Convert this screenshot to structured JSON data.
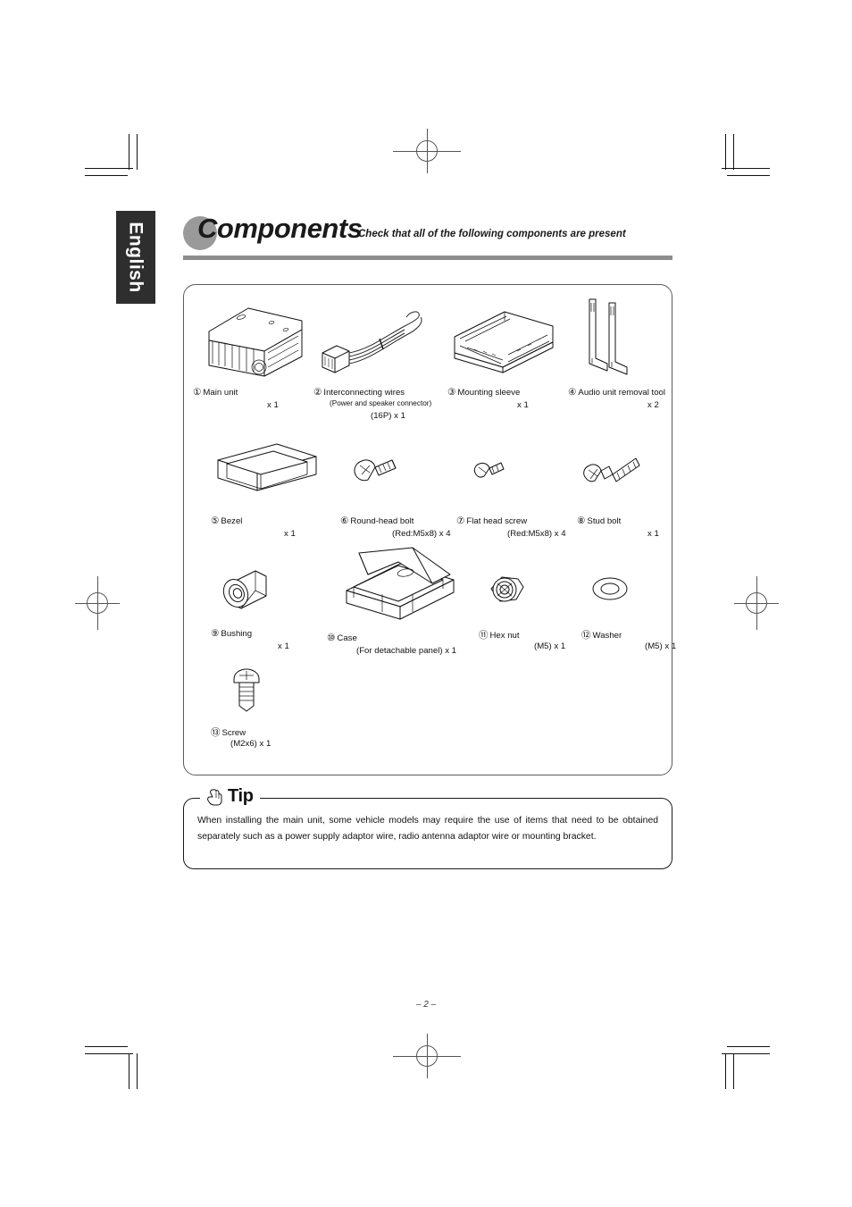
{
  "language_tab": "English",
  "header": {
    "title": "Components",
    "subtitle": "Check that all of the following components are present"
  },
  "components": [
    {
      "num": "1",
      "marker": "①",
      "name": "Main unit",
      "qty": "x 1",
      "note": ""
    },
    {
      "num": "2",
      "marker": "②",
      "name": "Interconnecting wires",
      "qty": "(16P) x 1",
      "note": "(Power and speaker connector)"
    },
    {
      "num": "3",
      "marker": "③",
      "name": "Mounting sleeve",
      "qty": "x 1",
      "note": ""
    },
    {
      "num": "4",
      "marker": "④",
      "name": "Audio unit removal tool",
      "qty": "x 2",
      "note": ""
    },
    {
      "num": "5",
      "marker": "⑤",
      "name": "Bezel",
      "qty": "x 1",
      "note": ""
    },
    {
      "num": "6",
      "marker": "⑥",
      "name": "Round-head bolt",
      "qty": "(Red:M5x8) x 4",
      "note": ""
    },
    {
      "num": "7",
      "marker": "⑦",
      "name": "Flat head screw",
      "qty": "(Red:M5x8) x 4",
      "note": ""
    },
    {
      "num": "8",
      "marker": "⑧",
      "name": "Stud bolt",
      "qty": "x 1",
      "note": ""
    },
    {
      "num": "9",
      "marker": "⑨",
      "name": "Bushing",
      "qty": "x 1",
      "note": ""
    },
    {
      "num": "10",
      "marker": "⑩",
      "name": "Case",
      "qty": "(For detachable panel) x 1",
      "note": ""
    },
    {
      "num": "11",
      "marker": "⑪",
      "name": "Hex nut",
      "qty": "(M5) x 1",
      "note": ""
    },
    {
      "num": "12",
      "marker": "⑫",
      "name": "Washer",
      "qty": "(M5) x 1",
      "note": ""
    },
    {
      "num": "13",
      "marker": "⑬",
      "name": "Screw",
      "qty": "(M2x6) x 1",
      "note": ""
    }
  ],
  "tip": {
    "label": "Tip",
    "body": "When installing the main unit, some vehicle models may require the use of items that need to be obtained separately such as a power supply adaptor wire, radio antenna adaptor wire or mounting bracket."
  },
  "footer": {
    "page_number": "– 2 –"
  },
  "colors": {
    "tab_background": "#2e2e2e",
    "rule": "#8d8d8d",
    "blob": "#9a9a9a",
    "ink": "#111111"
  }
}
